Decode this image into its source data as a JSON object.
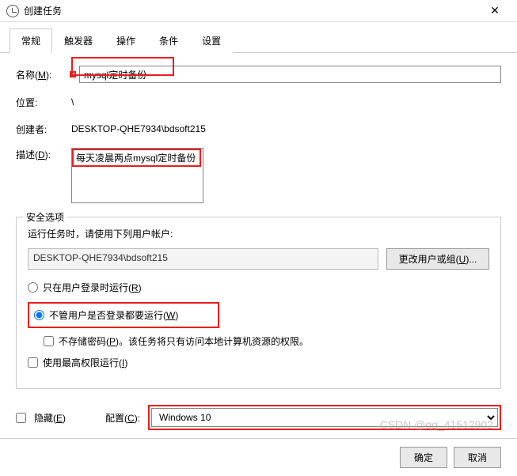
{
  "window": {
    "title": "创建任务"
  },
  "tabs": {
    "general": "常规",
    "triggers": "触发器",
    "actions": "操作",
    "conditions": "条件",
    "settings": "设置"
  },
  "form": {
    "name_label": "名称(M):",
    "name_value": "mysql定时备份",
    "location_label": "位置:",
    "location_value": "\\",
    "creator_label": "创建者:",
    "creator_value": "DESKTOP-QHE7934\\bdsoft215",
    "desc_label": "描述(D):",
    "desc_value": "每天凌晨两点mysql定时备份"
  },
  "security": {
    "legend": "安全选项",
    "help": "运行任务时，请使用下列用户帐户:",
    "user": "DESKTOP-QHE7934\\bdsoft215",
    "change_user_btn": "更改用户或组(U)...",
    "radio_logged_on": "只在用户登录时运行(R)",
    "radio_always": "不管用户是否登录都要运行(W)",
    "no_store_pwd": "不存储密码(P)。该任务将只有访问本地计算机资源的权限。",
    "highest_priv": "使用最高权限运行(I)"
  },
  "bottom": {
    "hidden_label": "隐藏(E)",
    "config_label": "配置(C):",
    "config_value": "Windows 10"
  },
  "footer": {
    "ok": "确定",
    "cancel": "取消"
  },
  "watermark": "CSDN @qq_41512902"
}
